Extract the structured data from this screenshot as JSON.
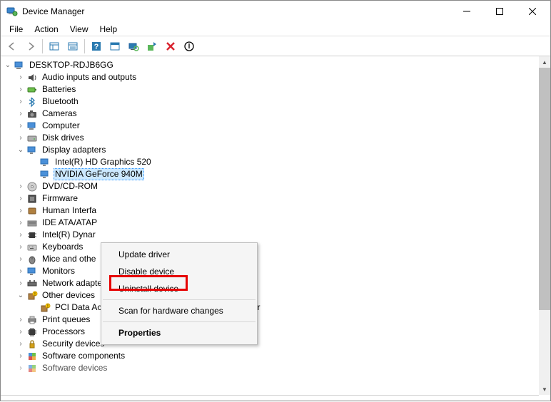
{
  "window": {
    "title": "Device Manager"
  },
  "menubar": [
    "File",
    "Action",
    "View",
    "Help"
  ],
  "computer_name": "DESKTOP-RDJB6GG",
  "tree": {
    "root": "DESKTOP-RDJB6GG",
    "categories": [
      {
        "label": "Audio inputs and outputs",
        "expanded": false
      },
      {
        "label": "Batteries",
        "expanded": false
      },
      {
        "label": "Bluetooth",
        "expanded": false
      },
      {
        "label": "Cameras",
        "expanded": false
      },
      {
        "label": "Computer",
        "expanded": false
      },
      {
        "label": "Disk drives",
        "expanded": false
      },
      {
        "label": "Display adapters",
        "expanded": true,
        "children": [
          {
            "label": "Intel(R) HD Graphics 520"
          },
          {
            "label": "NVIDIA GeForce 940M",
            "selected": true
          }
        ]
      },
      {
        "label": "DVD/CD-ROM",
        "expanded": false,
        "truncated": true
      },
      {
        "label": "Firmware",
        "expanded": false
      },
      {
        "label": "Human Interfa",
        "expanded": false,
        "truncated": true
      },
      {
        "label": "IDE ATA/ATAP",
        "expanded": false,
        "truncated": true
      },
      {
        "label": "Intel(R) Dynar",
        "expanded": false,
        "truncated": true
      },
      {
        "label": "Keyboards",
        "expanded": false
      },
      {
        "label": "Mice and othe",
        "expanded": false,
        "truncated": true
      },
      {
        "label": "Monitors",
        "expanded": false
      },
      {
        "label": "Network adapters",
        "expanded": false
      },
      {
        "label": "Other devices",
        "expanded": true,
        "children": [
          {
            "label": "PCI Data Acquisition and Signal Processing Controller",
            "warning": true
          }
        ]
      },
      {
        "label": "Print queues",
        "expanded": false
      },
      {
        "label": "Processors",
        "expanded": false
      },
      {
        "label": "Security devices",
        "expanded": false
      },
      {
        "label": "Software components",
        "expanded": false
      },
      {
        "label": "Software devices",
        "expanded": false,
        "partial": true
      }
    ]
  },
  "context_menu": {
    "items": [
      {
        "label": "Update driver"
      },
      {
        "label": "Disable device"
      },
      {
        "label": "Uninstall device",
        "highlighted": true
      },
      {
        "sep": true
      },
      {
        "label": "Scan for hardware changes"
      },
      {
        "sep": true
      },
      {
        "label": "Properties",
        "bold": true
      }
    ]
  }
}
